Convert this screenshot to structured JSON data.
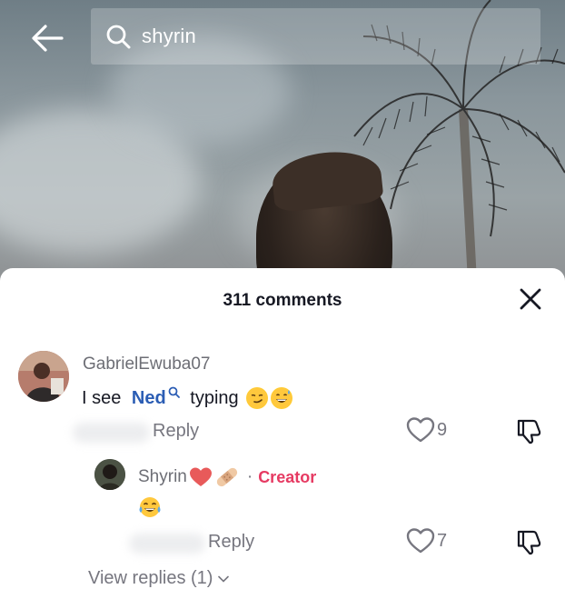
{
  "search": {
    "query": "shyrin"
  },
  "comments_panel": {
    "title": "311 comments",
    "comments": [
      {
        "username": "GabrielEwuba07",
        "text_prefix": "I see ",
        "mention": "Ned",
        "text_suffix": " typing",
        "emojis": [
          "smirking-face",
          "grinning-sweat-face"
        ],
        "reply_label": "Reply",
        "likes": "9"
      },
      {
        "username": "Shyrin",
        "username_emojis": [
          "red-heart",
          "adhesive-bandage"
        ],
        "separator": "·",
        "badge": "Creator",
        "emojis": [
          "tears-of-joy-face"
        ],
        "reply_label": "Reply",
        "likes": "7"
      }
    ],
    "view_replies": "View replies (1)"
  },
  "colors": {
    "accent_creator": "#e63a62",
    "mention": "#2b5db4",
    "muted_text": "#76767f"
  }
}
